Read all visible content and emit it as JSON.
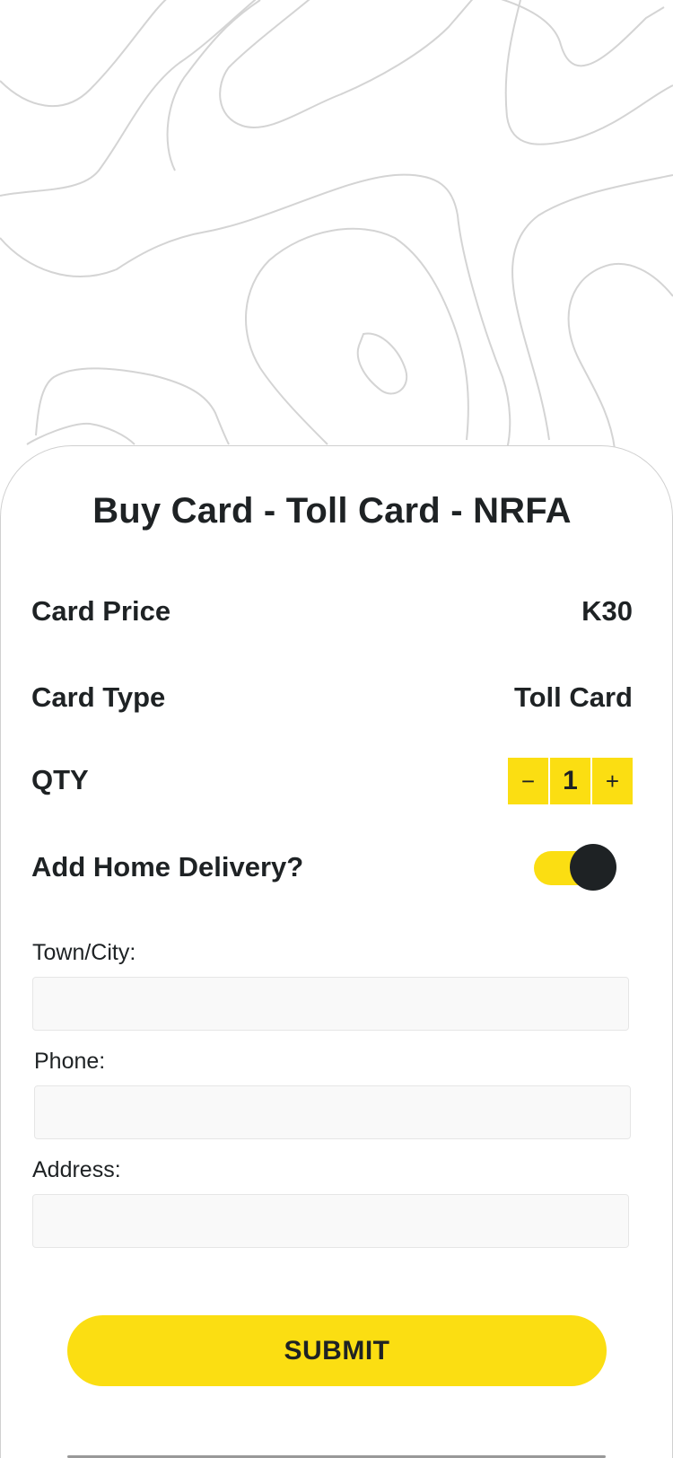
{
  "page": {
    "title": "Buy Card - Toll Card - NRFA"
  },
  "details": {
    "price_label": "Card Price",
    "price_value": "K30",
    "type_label": "Card Type",
    "type_value": "Toll Card",
    "qty_label": "QTY",
    "qty_value": "1",
    "qty_decrement": "−",
    "qty_increment": "+"
  },
  "delivery": {
    "label": "Add Home Delivery?",
    "enabled": true
  },
  "form": {
    "town_label": "Town/City:",
    "town_value": "",
    "phone_label": "Phone:",
    "phone_value": "",
    "address_label": "Address:",
    "address_value": ""
  },
  "actions": {
    "submit_label": "SUBMIT"
  },
  "colors": {
    "accent": "#fbde12",
    "text": "#1e2224",
    "field_bg": "#f9f9f9",
    "background_pattern": "#d4d4d4"
  },
  "icons": {
    "background": "topographic-pattern"
  }
}
